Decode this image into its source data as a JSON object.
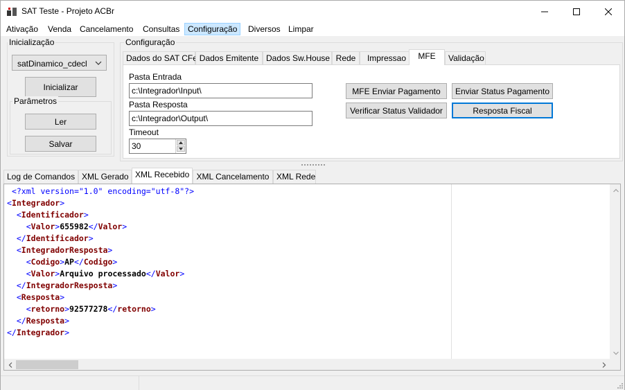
{
  "window": {
    "title": "SAT Teste - Projeto ACBr",
    "icons": {
      "app": "sat-app-icon",
      "minimize": "minimize-icon",
      "maximize": "maximize-icon",
      "close": "close-icon"
    }
  },
  "menu": [
    "Ativação",
    "Venda",
    "Cancelamento",
    "Consultas",
    "Configuração",
    "Diversos",
    "Limpar"
  ],
  "init_group": {
    "label": "Inicialização",
    "model_combo": "satDinamico_cdecl",
    "init_button": "Inicializar",
    "params_label": "Parâmetros",
    "read_button": "Ler",
    "save_button": "Salvar"
  },
  "config_group": {
    "label": "Configuração",
    "tabs": [
      "Dados do SAT CFe",
      "Dados Emitente",
      "Dados Sw.House",
      "Rede",
      "Impressao",
      "MFE",
      "Validação"
    ],
    "selected_tab": "MFE",
    "mfe": {
      "input_folder_label": "Pasta Entrada",
      "input_folder_value": "c:\\Integrador\\Input\\",
      "response_folder_label": "Pasta Resposta",
      "response_folder_value": "c:\\Integrador\\Output\\",
      "timeout_label": "Timeout",
      "timeout_value": "30",
      "buttons": {
        "send_payment": "MFE Enviar Pagamento",
        "send_payment_status": "Enviar Status Pagamento",
        "check_validator_status": "Verificar Status Validador",
        "fiscal_response": "Resposta Fiscal"
      }
    }
  },
  "log_tabs": [
    "Log de Comandos",
    "XML Gerado",
    "XML Recebido",
    "XML Cancelamento",
    "XML Rede"
  ],
  "selected_log_tab": "XML Recebido",
  "xml_lines": [
    {
      "indent": 1,
      "decl": "<?xml version=\"1.0\" encoding=\"utf-8\"?>"
    },
    {
      "indent": 0,
      "open": "Integrador"
    },
    {
      "indent": 2,
      "open": "Identificador"
    },
    {
      "indent": 4,
      "open": "Valor",
      "text": "655982",
      "close": "Valor"
    },
    {
      "indent": 2,
      "close": "Identificador"
    },
    {
      "indent": 2,
      "open": "IntegradorResposta"
    },
    {
      "indent": 4,
      "open": "Codigo",
      "text": "AP",
      "close": "Codigo"
    },
    {
      "indent": 4,
      "open": "Valor",
      "text": "Arquivo processado",
      "close": "Valor"
    },
    {
      "indent": 2,
      "close": "IntegradorResposta"
    },
    {
      "indent": 2,
      "open": "Resposta"
    },
    {
      "indent": 4,
      "open": "retorno",
      "text": "92577278",
      "close": "retorno"
    },
    {
      "indent": 2,
      "close": "Resposta"
    },
    {
      "indent": 0,
      "close": "Integrador"
    }
  ],
  "colors": {
    "focus": "#0078d7",
    "menu_highlight": "#cce8ff",
    "xml_tag": "#800000",
    "xml_bracket": "#0000ff"
  }
}
